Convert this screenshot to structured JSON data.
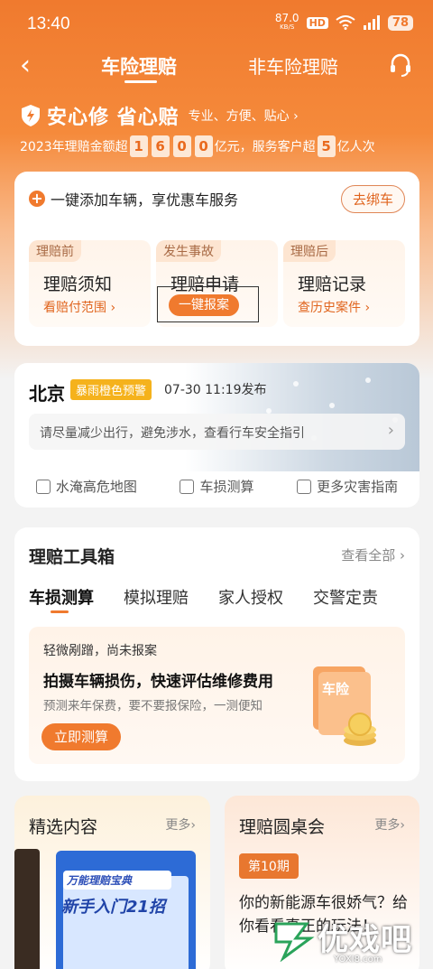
{
  "status_bar": {
    "time": "13:40",
    "net_speed": "87.0",
    "net_unit": "KB/S",
    "hd": "HD",
    "battery": "78"
  },
  "nav": {
    "tab_active": "车险理赔",
    "tab_other": "非车险理赔"
  },
  "hero": {
    "slogan": "安心修 省心赔",
    "tagline": "专业、方便、贴心 ›",
    "stats_prefix": "2023年理赔金额超",
    "amount_digits": [
      "1",
      "6",
      "0",
      "0"
    ],
    "amount_unit": "亿元，服务客户超",
    "customers_digit": "5",
    "customers_unit": "亿人次"
  },
  "car_card": {
    "add_text": "一键添加车辆，享优惠车服务",
    "bind_button": "去绑车",
    "sections": [
      {
        "tag": "理赔前",
        "title": "理赔须知",
        "link": "看赔付范围 ›"
      },
      {
        "tag": "发生事故",
        "title": "理赔申请",
        "button": "一键报案"
      },
      {
        "tag": "理赔后",
        "title": "理赔记录",
        "link": "查历史案件 ›"
      }
    ]
  },
  "weather": {
    "city": "北京",
    "warning": "暴雨橙色预警",
    "published": "07-30 11:19发布",
    "advice": "请尽量减少出行，避免涉水，查看行车安全指引",
    "links": [
      "水淹高危地图",
      "车损测算",
      "更多灾害指南"
    ]
  },
  "toolbox": {
    "title": "理赔工具箱",
    "see_all": "查看全部 ›",
    "tabs": [
      "车损测算",
      "模拟理赔",
      "家人授权",
      "交警定责"
    ],
    "panel": {
      "line1": "轻微剐蹭，尚未报案",
      "line2": "拍摄车辆损伤，快速评估维修费用",
      "line3": "预测来年保费，要不要报保险，一测便知",
      "button": "立即测算",
      "art_label": "车险"
    }
  },
  "featured": {
    "title": "精选内容",
    "more": "更多›",
    "poster_line1": "万能理赔宝典",
    "poster_line2": "新手入门21招"
  },
  "roundtable": {
    "title": "理赔圆桌会",
    "more": "更多›",
    "issue": "第10期",
    "question": "你的新能源车很娇气？给你看看真正的玩法！"
  },
  "watermark": {
    "text": "优戏吧",
    "url": "YOXI8.com"
  },
  "colors": {
    "accent": "#f07a2e",
    "warning": "#f5b21c"
  }
}
